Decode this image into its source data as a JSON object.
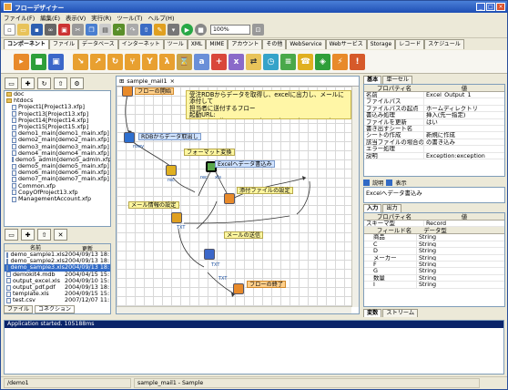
{
  "window": {
    "title": "フローデザイナー",
    "controls": [
      "_",
      "□",
      "×"
    ]
  },
  "menu": [
    "ファイル(F)",
    "編集(E)",
    "表示(V)",
    "実行(R)",
    "ツール(T)",
    "ヘルプ(H)"
  ],
  "toolbar": {
    "zoom": "100%"
  },
  "category_tabs": [
    "コンポーネント",
    "ファイル",
    "データベース",
    "インターネット",
    "ツール",
    "XML",
    "MIME",
    "アカウント",
    "その他",
    "WebService",
    "Webサービス",
    "Storage",
    "レコード",
    "スケジュール"
  ],
  "category_tabs_active": 0,
  "tree": [
    {
      "label": "doc",
      "type": "folder"
    },
    {
      "label": "htdocs",
      "type": "folder"
    },
    {
      "label": "Project1[Project13.xfp]",
      "type": "file"
    },
    {
      "label": "Project13[Project13.xfp]",
      "type": "file"
    },
    {
      "label": "Project14[Project14.xfp]",
      "type": "file"
    },
    {
      "label": "Project15[Project15.xfp]",
      "type": "file"
    },
    {
      "label": "demo1_main[demo1_main.xfp]",
      "type": "file"
    },
    {
      "label": "demo2_main[demo2_main.xfp]",
      "type": "file"
    },
    {
      "label": "demo3_main[demo3_main.xfp]",
      "type": "file"
    },
    {
      "label": "demo4_main[demo4_main.xfp]",
      "type": "file"
    },
    {
      "label": "demo5_admin[demo5_admin.xfp]",
      "type": "file"
    },
    {
      "label": "demo5_main[demo5_main.xfp]",
      "type": "file"
    },
    {
      "label": "demo6_main[demo6_main.xfp]",
      "type": "file"
    },
    {
      "label": "demo7_main[demo7_main.xfp]",
      "type": "file"
    },
    {
      "label": "Common.xfp",
      "type": "file"
    },
    {
      "label": "CopyOfProject13.xfp",
      "type": "file"
    },
    {
      "label": "ManagementAccount.xfp",
      "type": "file"
    }
  ],
  "filelist": {
    "columns": [
      "名前",
      "更新"
    ],
    "rows": [
      {
        "name": "demo_sample1.xls",
        "date": "2004/09/13 18:"
      },
      {
        "name": "demo_sample2.xls",
        "date": "2004/09/13 18:"
      },
      {
        "name": "demo_sample3.xls",
        "date": "2004/09/13 18:"
      },
      {
        "name": "demokit4.mdb",
        "date": "2004/04/15 15:"
      },
      {
        "name": "output_excel.xls",
        "date": "2004/09/10 15:"
      },
      {
        "name": "output_pdf.pdf",
        "date": "2004/09/13 18:"
      },
      {
        "name": "template.xls",
        "date": "2004/09/15 15:"
      },
      {
        "name": "test.csv",
        "date": "2007/12/07 11:"
      }
    ],
    "selected": 2
  },
  "left_bottom_tabs": [
    "ファイル",
    "コネクション"
  ],
  "canvas_tab": "sample_mail1",
  "memo": {
    "lines": [
      "受注RDBからデータを取得し、excelに出力し、メールに添付して",
      "担当者に送付するフロー",
      "起動URL: http://localhost:21380/demo/demo/demo1_main"
    ]
  },
  "flow_nodes": {
    "start": "フローの開始",
    "rdb": "RDBからデータ取出し",
    "format": "フォーマット変換",
    "excel": "Excelへデータ書込み",
    "attach": "添付ファイルの設定",
    "mailinfo": "メール情報の設定",
    "send": "メールの送信",
    "end": "フローの終了",
    "tags": [
      "rowv",
      "rec",
      "rec",
      "xls",
      "TXT",
      "TXT",
      "TXT"
    ]
  },
  "right_tabs": [
    "基本",
    "単一セル"
  ],
  "props": {
    "header": [
      "プロパティ名",
      "値"
    ],
    "rows": [
      {
        "k": "名前",
        "v": "Excel_Output_1"
      },
      {
        "k": "ファイルパス",
        "v": ""
      },
      {
        "k": "ファイルパスの起点",
        "v": "ホームディレクトリ"
      },
      {
        "k": "書込み処理",
        "v": "挿入(先一指定)"
      },
      {
        "k": "ファイルを更新",
        "v": "はい"
      },
      {
        "k": "書き出すシート名",
        "v": ""
      },
      {
        "k": "シートの作成",
        "v": "新規に作成"
      },
      {
        "k": "該当ファイルの場合の処理",
        "v": "の書き込み"
      },
      {
        "k": "エラー処理",
        "v": ""
      },
      {
        "k": "説明",
        "v": "Exception:exception"
      }
    ]
  },
  "desc": {
    "label": "説明",
    "show": "表示",
    "text": "Excelへデータ書込み"
  },
  "io_tabs": [
    "入力",
    "出力"
  ],
  "record": {
    "header": [
      "プロパティ名",
      "値"
    ],
    "name_row": {
      "k": "スキーマ型",
      "v": "Record"
    },
    "field_header": [
      "フィールド名",
      "データ型"
    ],
    "fields": [
      {
        "name": "商品",
        "type": "String"
      },
      {
        "name": "C",
        "type": "String"
      },
      {
        "name": "D",
        "type": "String"
      },
      {
        "name": "メーカー",
        "type": "String"
      },
      {
        "name": "F",
        "type": "String"
      },
      {
        "name": "G",
        "type": "String"
      },
      {
        "name": "数量",
        "type": "String"
      },
      {
        "name": "I",
        "type": "String"
      }
    ]
  },
  "right_bottom_tabs": [
    "変数",
    "ストリーム"
  ],
  "console": {
    "header": "Application started. 105188ms"
  },
  "statusbar": {
    "left": "/demo1",
    "right": "sample_mail1 - Sample"
  }
}
